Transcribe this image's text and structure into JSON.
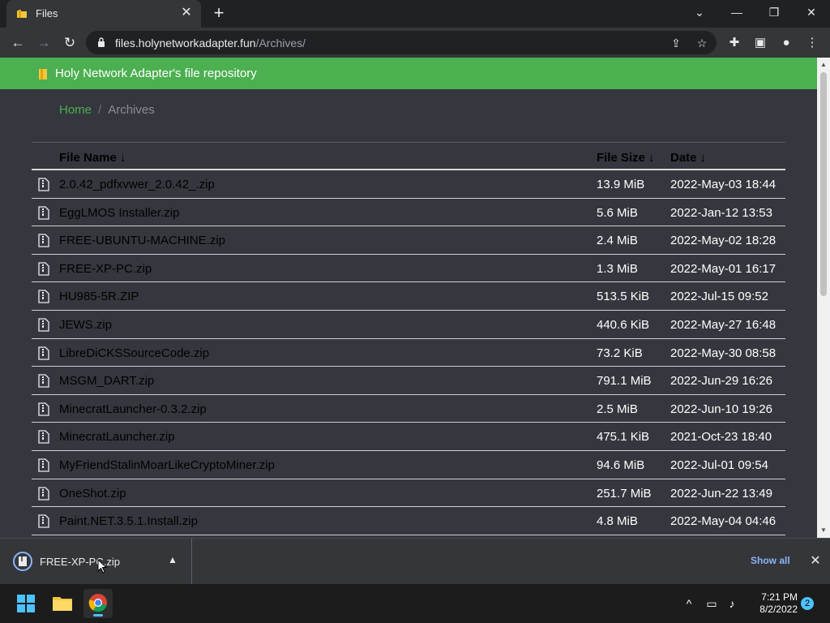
{
  "browser": {
    "tab_title": "Files",
    "new_tab_label": "+",
    "url_host": "files.holynetworkadapter.fun",
    "url_path": "/Archives/"
  },
  "page": {
    "banner_title": "Holy Network Adapter's file repository",
    "breadcrumb": {
      "home": "Home",
      "separator": "/",
      "current": "Archives"
    },
    "columns": {
      "name": "File Name",
      "size": "File Size",
      "date": "Date",
      "sort_arrow": "↓"
    },
    "files": [
      {
        "name": "2.0.42_pdfxvwer_2.0.42_.zip",
        "size": "13.9 MiB",
        "date": "2022-May-03 18:44"
      },
      {
        "name": "EggLMOS Installer.zip",
        "size": "5.6 MiB",
        "date": "2022-Jan-12 13:53"
      },
      {
        "name": "FREE-UBUNTU-MACHINE.zip",
        "size": "2.4 MiB",
        "date": "2022-May-02 18:28"
      },
      {
        "name": "FREE-XP-PC.zip",
        "size": "1.3 MiB",
        "date": "2022-May-01 16:17"
      },
      {
        "name": "HU985-5R.ZIP",
        "size": "513.5 KiB",
        "date": "2022-Jul-15 09:52"
      },
      {
        "name": "JEWS.zip",
        "size": "440.6 KiB",
        "date": "2022-May-27 16:48"
      },
      {
        "name": "LibreDiCKSSourceCode.zip",
        "size": "73.2 KiB",
        "date": "2022-May-30 08:58"
      },
      {
        "name": "MSGM_DART.zip",
        "size": "791.1 MiB",
        "date": "2022-Jun-29 16:26"
      },
      {
        "name": "MinecratLauncher-0.3.2.zip",
        "size": "2.5 MiB",
        "date": "2022-Jun-10 19:26"
      },
      {
        "name": "MinecratLauncher.zip",
        "size": "475.1 KiB",
        "date": "2021-Oct-23 18:40"
      },
      {
        "name": "MyFriendStalinMoarLikeCryptoMiner.zip",
        "size": "94.6 MiB",
        "date": "2022-Jul-01 09:54"
      },
      {
        "name": "OneShot.zip",
        "size": "251.7 MiB",
        "date": "2022-Jun-22 13:49"
      },
      {
        "name": "Paint.NET.3.5.1.Install.zip",
        "size": "4.8 MiB",
        "date": "2022-May-04 04:46"
      }
    ]
  },
  "download_bar": {
    "file_name": "FREE-XP-PC.zip",
    "show_all": "Show all"
  },
  "taskbar": {
    "time": "7:21 PM",
    "date": "8/2/2022",
    "notification_count": "2"
  },
  "colors": {
    "banner": "#4caf50",
    "page_bg": "#34373d",
    "link": "#4caf50",
    "show_all": "#8ab4f8",
    "accent": "#4cc2ff"
  },
  "icons": [
    "folder-icon",
    "close-icon",
    "plus-icon",
    "back-arrow-icon",
    "forward-arrow-icon",
    "reload-icon",
    "lock-icon",
    "share-icon",
    "star-icon",
    "extensions-icon",
    "side-panel-icon",
    "profile-icon",
    "kebab-menu-icon",
    "zip-file-icon",
    "chevron-up-icon",
    "windows-start-icon",
    "file-explorer-icon",
    "chrome-icon",
    "network-icon",
    "volume-icon"
  ]
}
